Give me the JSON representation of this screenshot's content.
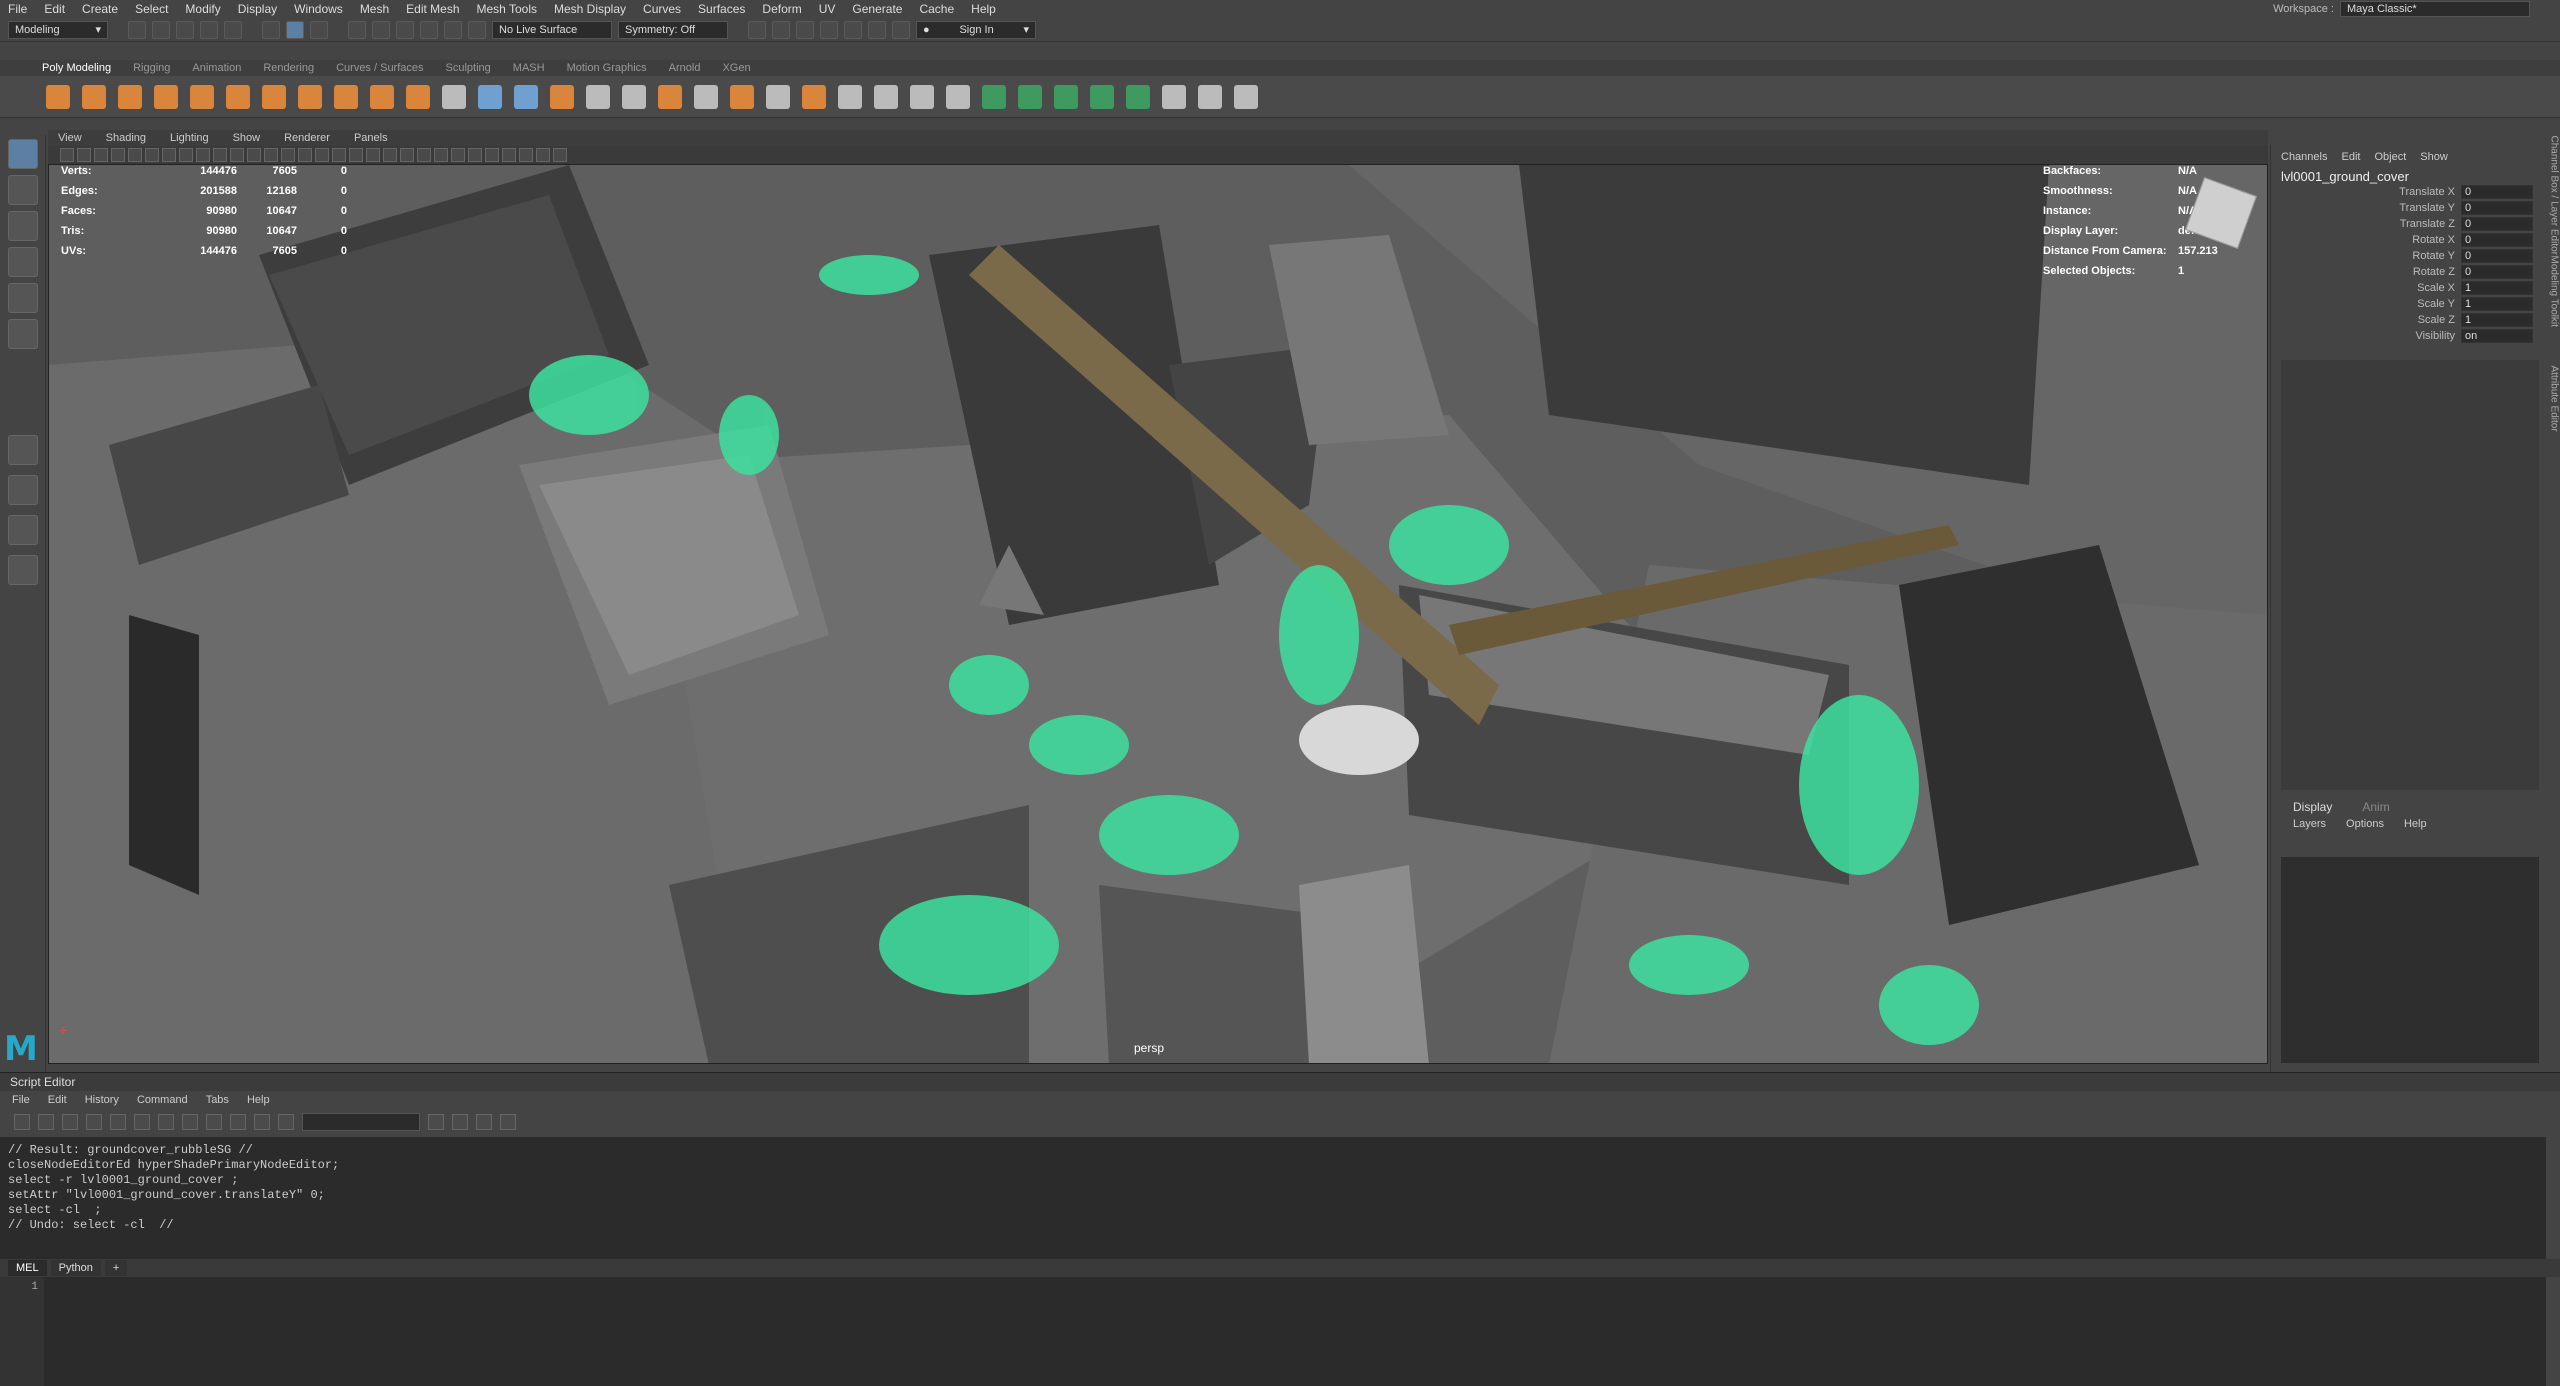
{
  "menubar": [
    "File",
    "Edit",
    "Create",
    "Select",
    "Modify",
    "Display",
    "Windows",
    "Mesh",
    "Edit Mesh",
    "Mesh Tools",
    "Mesh Display",
    "Curves",
    "Surfaces",
    "Deform",
    "UV",
    "Generate",
    "Cache",
    "Help"
  ],
  "workspace": {
    "label": "Workspace :",
    "value": "Maya Classic*"
  },
  "status": {
    "mode": "Modeling",
    "live_surface": "No Live Surface",
    "symmetry": "Symmetry: Off",
    "sign_in": "Sign In"
  },
  "shelf_tabs": [
    "Poly Modeling",
    "Rigging",
    "Animation",
    "Rendering",
    "Curves / Surfaces",
    "Sculpting",
    "MASH",
    "Motion Graphics",
    "Arnold",
    "XGen"
  ],
  "viewport": {
    "menu": [
      "View",
      "Shading",
      "Lighting",
      "Show",
      "Renderer",
      "Panels"
    ],
    "camera": "persp",
    "hud_left": [
      {
        "label": "Verts:",
        "v1": "144476",
        "v2": "7605",
        "v3": "0"
      },
      {
        "label": "Edges:",
        "v1": "201588",
        "v2": "12168",
        "v3": "0"
      },
      {
        "label": "Faces:",
        "v1": "90980",
        "v2": "10647",
        "v3": "0"
      },
      {
        "label": "Tris:",
        "v1": "90980",
        "v2": "10647",
        "v3": "0"
      },
      {
        "label": "UVs:",
        "v1": "144476",
        "v2": "7605",
        "v3": "0"
      }
    ],
    "hud_right": [
      {
        "label": "Backfaces:",
        "value": "N/A"
      },
      {
        "label": "Smoothness:",
        "value": "N/A"
      },
      {
        "label": "Instance:",
        "value": "N/A"
      },
      {
        "label": "Display Layer:",
        "value": "default"
      },
      {
        "label": "Distance From Camera:",
        "value": "157.213"
      },
      {
        "label": "Selected Objects:",
        "value": "1"
      }
    ]
  },
  "channel_box": {
    "menu": [
      "Channels",
      "Edit",
      "Object",
      "Show"
    ],
    "object": "lvl0001_ground_cover",
    "attrs": [
      {
        "name": "Translate X",
        "value": "0"
      },
      {
        "name": "Translate Y",
        "value": "0"
      },
      {
        "name": "Translate Z",
        "value": "0"
      },
      {
        "name": "Rotate X",
        "value": "0"
      },
      {
        "name": "Rotate Y",
        "value": "0"
      },
      {
        "name": "Rotate Z",
        "value": "0"
      },
      {
        "name": "Scale X",
        "value": "1"
      },
      {
        "name": "Scale Y",
        "value": "1"
      },
      {
        "name": "Scale Z",
        "value": "1"
      },
      {
        "name": "Visibility",
        "value": "on"
      }
    ],
    "display_tabs": [
      "Display",
      "Anim"
    ],
    "display_menu": [
      "Layers",
      "Options",
      "Help"
    ]
  },
  "side_tabs": [
    "Channel Box / Layer Editor",
    "Modeling Toolkit",
    "Attribute Editor"
  ],
  "script_editor": {
    "title": "Script Editor",
    "menu": [
      "File",
      "Edit",
      "History",
      "Command",
      "Tabs",
      "Help"
    ],
    "history": "// Result: groundcover_rubbleSG //\ncloseNodeEditorEd hyperShadePrimaryNodeEditor;\nselect -r lvl0001_ground_cover ;\nsetAttr \"lvl0001_ground_cover.translateY\" 0;\nselect -cl  ;\n// Undo: select -cl  //",
    "tabs": [
      "MEL",
      "Python",
      "+"
    ],
    "line_no": "1"
  },
  "logo": "M"
}
